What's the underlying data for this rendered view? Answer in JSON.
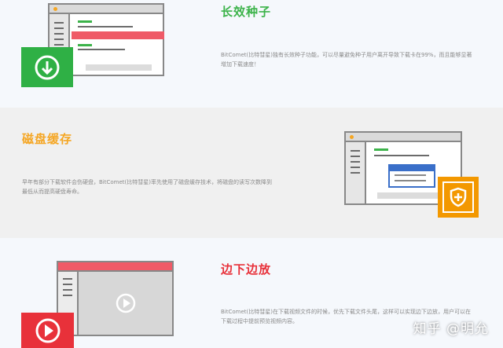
{
  "sections": [
    {
      "title": "长效种子",
      "title_color": "#3cb34a",
      "desc_line1": "BitComet(比特彗星)独有长效种子功能，可以尽量避免种子用户离开导致下载卡在99%，而且能够显著",
      "desc_line2": "增加下载速度！",
      "icon": "download-icon",
      "icon_color": "#2fb045"
    },
    {
      "title": "磁盘缓存",
      "title_color": "#f5a623",
      "desc_line1": "早年有部分下载软件会伤硬盘，BitComet(比特彗星)率先使用了磁盘缓存技术，将磁盘的读写次数降到",
      "desc_line2": "最低从而提高硬盘寿命。",
      "icon": "shield-plus-icon",
      "icon_color": "#f39800"
    },
    {
      "title": "边下边放",
      "title_color": "#e8313a",
      "desc_line1": "BitComet(比特彗星)在下载视频文件的时候，优先下载文件头尾，这样可以实现边下边放，用户可以在",
      "desc_line2": "下载过程中提前预览视频内容。",
      "icon": "play-icon",
      "icon_color": "#e8313a"
    }
  ],
  "watermark": "知乎 @明允"
}
